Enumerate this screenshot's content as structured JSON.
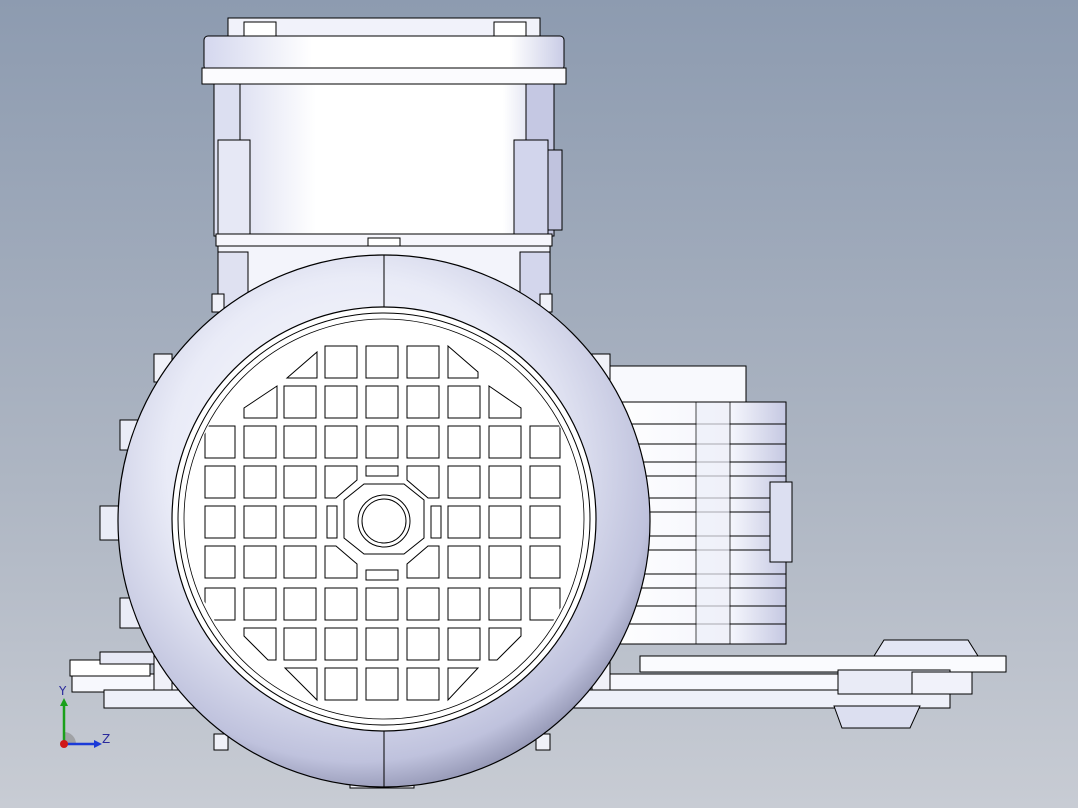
{
  "viewport": {
    "background_top": "#8d9bb0",
    "background_bottom": "#c8ccd4",
    "model_edge_color": "#000000",
    "model_fill": "#ffffff"
  },
  "triad": {
    "y_label": "Y",
    "z_label": "Z",
    "y_color": "#1aa01a",
    "z_color": "#1a3ad8",
    "x_color": "#d01818"
  }
}
